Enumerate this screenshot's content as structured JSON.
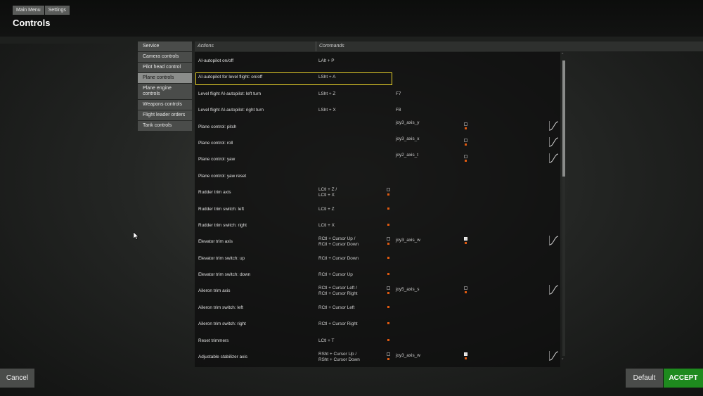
{
  "breadcrumb": [
    "Main Menu",
    "Settings"
  ],
  "page_title": "Controls",
  "categories": [
    {
      "label": "Service",
      "active": false
    },
    {
      "label": "Camera controls",
      "active": false
    },
    {
      "label": "Pilot head control",
      "active": false
    },
    {
      "label": "Plane controls",
      "active": true
    },
    {
      "label": "Plane engine controls",
      "active": false
    },
    {
      "label": "Weapons controls",
      "active": false
    },
    {
      "label": "Flight leader orders",
      "active": false
    },
    {
      "label": "Tank controls",
      "active": false
    }
  ],
  "table": {
    "col_actions": "Actions",
    "col_commands": "Commands",
    "rows": [
      {
        "action": "AI-autopilot on/off",
        "cmd": [
          "LAlt + P"
        ],
        "cmd2": "",
        "axis": "",
        "icon_primary": false,
        "icon_axis": false,
        "axis_icon_bright": false,
        "curve": false
      },
      {
        "action": "AI-autopilot for level flight: on/off",
        "cmd": [
          "LSht + A"
        ],
        "cmd2": "",
        "axis": "",
        "icon_primary": false,
        "icon_axis": false,
        "axis_icon_bright": false,
        "curve": false,
        "highlighted": true
      },
      {
        "action": "Level flight AI-autopilot: left turn",
        "cmd": [
          "LSht + Z"
        ],
        "cmd2": "F7",
        "axis": "",
        "icon_primary": false,
        "icon_axis": false,
        "axis_icon_bright": false,
        "curve": false
      },
      {
        "action": "Level flight AI-autopilot: right turn",
        "cmd": [
          "LSht + X"
        ],
        "cmd2": "F8",
        "axis": "",
        "icon_primary": false,
        "icon_axis": false,
        "axis_icon_bright": false,
        "curve": false
      },
      {
        "action": "Plane control: pitch",
        "cmd": [],
        "cmd2": "",
        "axis": "joy3_axis_y",
        "icon_primary": false,
        "icon_axis": true,
        "axis_icon_bright": false,
        "curve": true
      },
      {
        "action": "Plane control: roll",
        "cmd": [],
        "cmd2": "",
        "axis": "joy3_axis_x",
        "icon_primary": false,
        "icon_axis": true,
        "axis_icon_bright": false,
        "curve": true
      },
      {
        "action": "Plane control: yaw",
        "cmd": [],
        "cmd2": "",
        "axis": "joy2_axis_t",
        "icon_primary": false,
        "icon_axis": true,
        "axis_icon_bright": false,
        "curve": true
      },
      {
        "action": "Plane control: yaw reset",
        "cmd": [],
        "cmd2": "",
        "axis": "",
        "icon_primary": false,
        "icon_axis": false,
        "axis_icon_bright": false,
        "curve": false
      },
      {
        "action": "Rudder trim axis",
        "cmd": [
          "LCtl + Z /",
          "LCtl + X"
        ],
        "cmd2": "",
        "axis": "",
        "icon_primary": true,
        "icon_axis": false,
        "axis_icon_bright": false,
        "curve": false
      },
      {
        "action": "Rudder trim switch: left",
        "cmd": [
          "LCtl + Z"
        ],
        "cmd2": "",
        "axis": "",
        "icon_primary": true,
        "icon_axis": false,
        "axis_icon_bright": false,
        "curve": false
      },
      {
        "action": "Rudder trim switch: right",
        "cmd": [
          "LCtl + X"
        ],
        "cmd2": "",
        "axis": "",
        "icon_primary": true,
        "icon_axis": false,
        "axis_icon_bright": false,
        "curve": false
      },
      {
        "action": "Elevator trim axis",
        "cmd": [
          "RCtl + Cursor Up /",
          "RCtl + Cursor Down"
        ],
        "cmd2": "",
        "axis": "joy3_axis_w",
        "icon_primary": true,
        "icon_axis": true,
        "axis_icon_bright": true,
        "curve": true
      },
      {
        "action": "Elevator trim switch: up",
        "cmd": [
          "RCtl + Cursor Down"
        ],
        "cmd2": "",
        "axis": "",
        "icon_primary": true,
        "icon_axis": false,
        "axis_icon_bright": false,
        "curve": false
      },
      {
        "action": "Elevator trim switch: down",
        "cmd": [
          "RCtl + Cursor Up"
        ],
        "cmd2": "",
        "axis": "",
        "icon_primary": true,
        "icon_axis": false,
        "axis_icon_bright": false,
        "curve": false
      },
      {
        "action": "Aileron trim axis",
        "cmd": [
          "RCtl + Cursor Left /",
          "RCtl + Cursor Right"
        ],
        "cmd2": "",
        "axis": "joy5_axis_s",
        "icon_primary": true,
        "icon_axis": true,
        "axis_icon_bright": false,
        "curve": true
      },
      {
        "action": "Aileron trim switch: left",
        "cmd": [
          "RCtl + Cursor Left"
        ],
        "cmd2": "",
        "axis": "",
        "icon_primary": true,
        "icon_axis": false,
        "axis_icon_bright": false,
        "curve": false
      },
      {
        "action": "Aileron trim switch: right",
        "cmd": [
          "RCtl + Cursor Right"
        ],
        "cmd2": "",
        "axis": "",
        "icon_primary": true,
        "icon_axis": false,
        "axis_icon_bright": false,
        "curve": false
      },
      {
        "action": "Reset trimmers",
        "cmd": [
          "LCtl + T"
        ],
        "cmd2": "",
        "axis": "",
        "icon_primary": true,
        "icon_axis": false,
        "axis_icon_bright": false,
        "curve": false
      },
      {
        "action": "Adjustable stabilizer axis",
        "cmd": [
          "RSht + Cursor Up /",
          "RSht + Cursor Down"
        ],
        "cmd2": "",
        "axis": "joy3_axis_w",
        "icon_primary": true,
        "icon_axis": true,
        "axis_icon_bright": true,
        "curve": true
      }
    ]
  },
  "buttons": {
    "cancel": "Cancel",
    "default": "Default",
    "accept": "ACCEPT"
  },
  "colors": {
    "highlight": "#e8d22a",
    "accept": "#1e8a1e",
    "active_category": "#8b8d8b"
  },
  "icons": {
    "scroll_up": "chevron-up-icon",
    "scroll_down": "chevron-down-icon",
    "curve": "response-curve-icon",
    "cursor": "mouse-cursor-icon"
  }
}
